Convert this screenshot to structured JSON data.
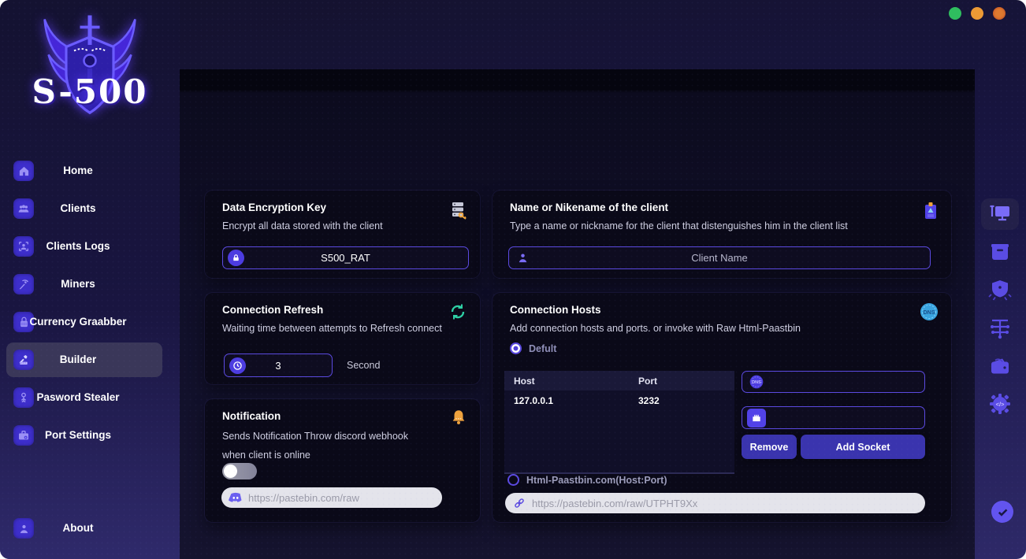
{
  "window_controls": [
    {
      "name": "green",
      "color": "#2fbe5f"
    },
    {
      "name": "orange",
      "color": "#ec9a35"
    },
    {
      "name": "amber",
      "color": "#de7a30"
    }
  ],
  "logo": {
    "title": "S-500"
  },
  "sidebar": {
    "items": [
      {
        "label": "Home"
      },
      {
        "label": "Clients"
      },
      {
        "label": "Clients Logs"
      },
      {
        "label": "Miners"
      },
      {
        "label": "Currency Graabber"
      },
      {
        "label": "Builder"
      },
      {
        "label": "Pasword Stealer"
      },
      {
        "label": "Port Settings"
      }
    ],
    "about": "About"
  },
  "encryption_card": {
    "title": "Data Encryption Key",
    "subtitle": "Encrypt all data stored with the client",
    "value": "S500_RAT"
  },
  "nickname_card": {
    "title": "Name or Nikename of the client",
    "subtitle": "Type a name or nickname for the client that  distenguishes him in the client list",
    "placeholder": "Client Name"
  },
  "refresh_card": {
    "title": "Connection Refresh",
    "subtitle": "Waiting time between attempts to Refresh connect",
    "value": "3",
    "unit": "Second"
  },
  "notification_card": {
    "title": "Notification",
    "subtitle_line1": "Sends Notification Throw discord webhook",
    "subtitle_line2": "when client is online",
    "toggle_on": false,
    "webhook_placeholder": "https://pastebin.com/raw"
  },
  "hosts_card": {
    "title": "Connection Hosts",
    "subtitle": "Add connection hosts and ports. or invoke with Raw Html-Paastbin",
    "radio_default_label": "Defult",
    "radio_pastebin_label": "Html-Paastbin.com(Host:Port)",
    "table": {
      "headers": [
        "Host",
        "Port"
      ],
      "rows": [
        [
          "127.0.0.1",
          "3232"
        ]
      ]
    },
    "remove_label": "Remove",
    "add_socket_label": "Add Socket",
    "pastebin_placeholder": "https://pastebin.com/raw/UTPHT9Xx"
  },
  "colors": {
    "accent": "#5b4ae0",
    "button": "#3a34ae",
    "refresh_teal": "#2ecfa4",
    "bell_orange": "#efa23d",
    "dns_blue": "#3aa4e0",
    "discord": "#6a5ff0"
  }
}
